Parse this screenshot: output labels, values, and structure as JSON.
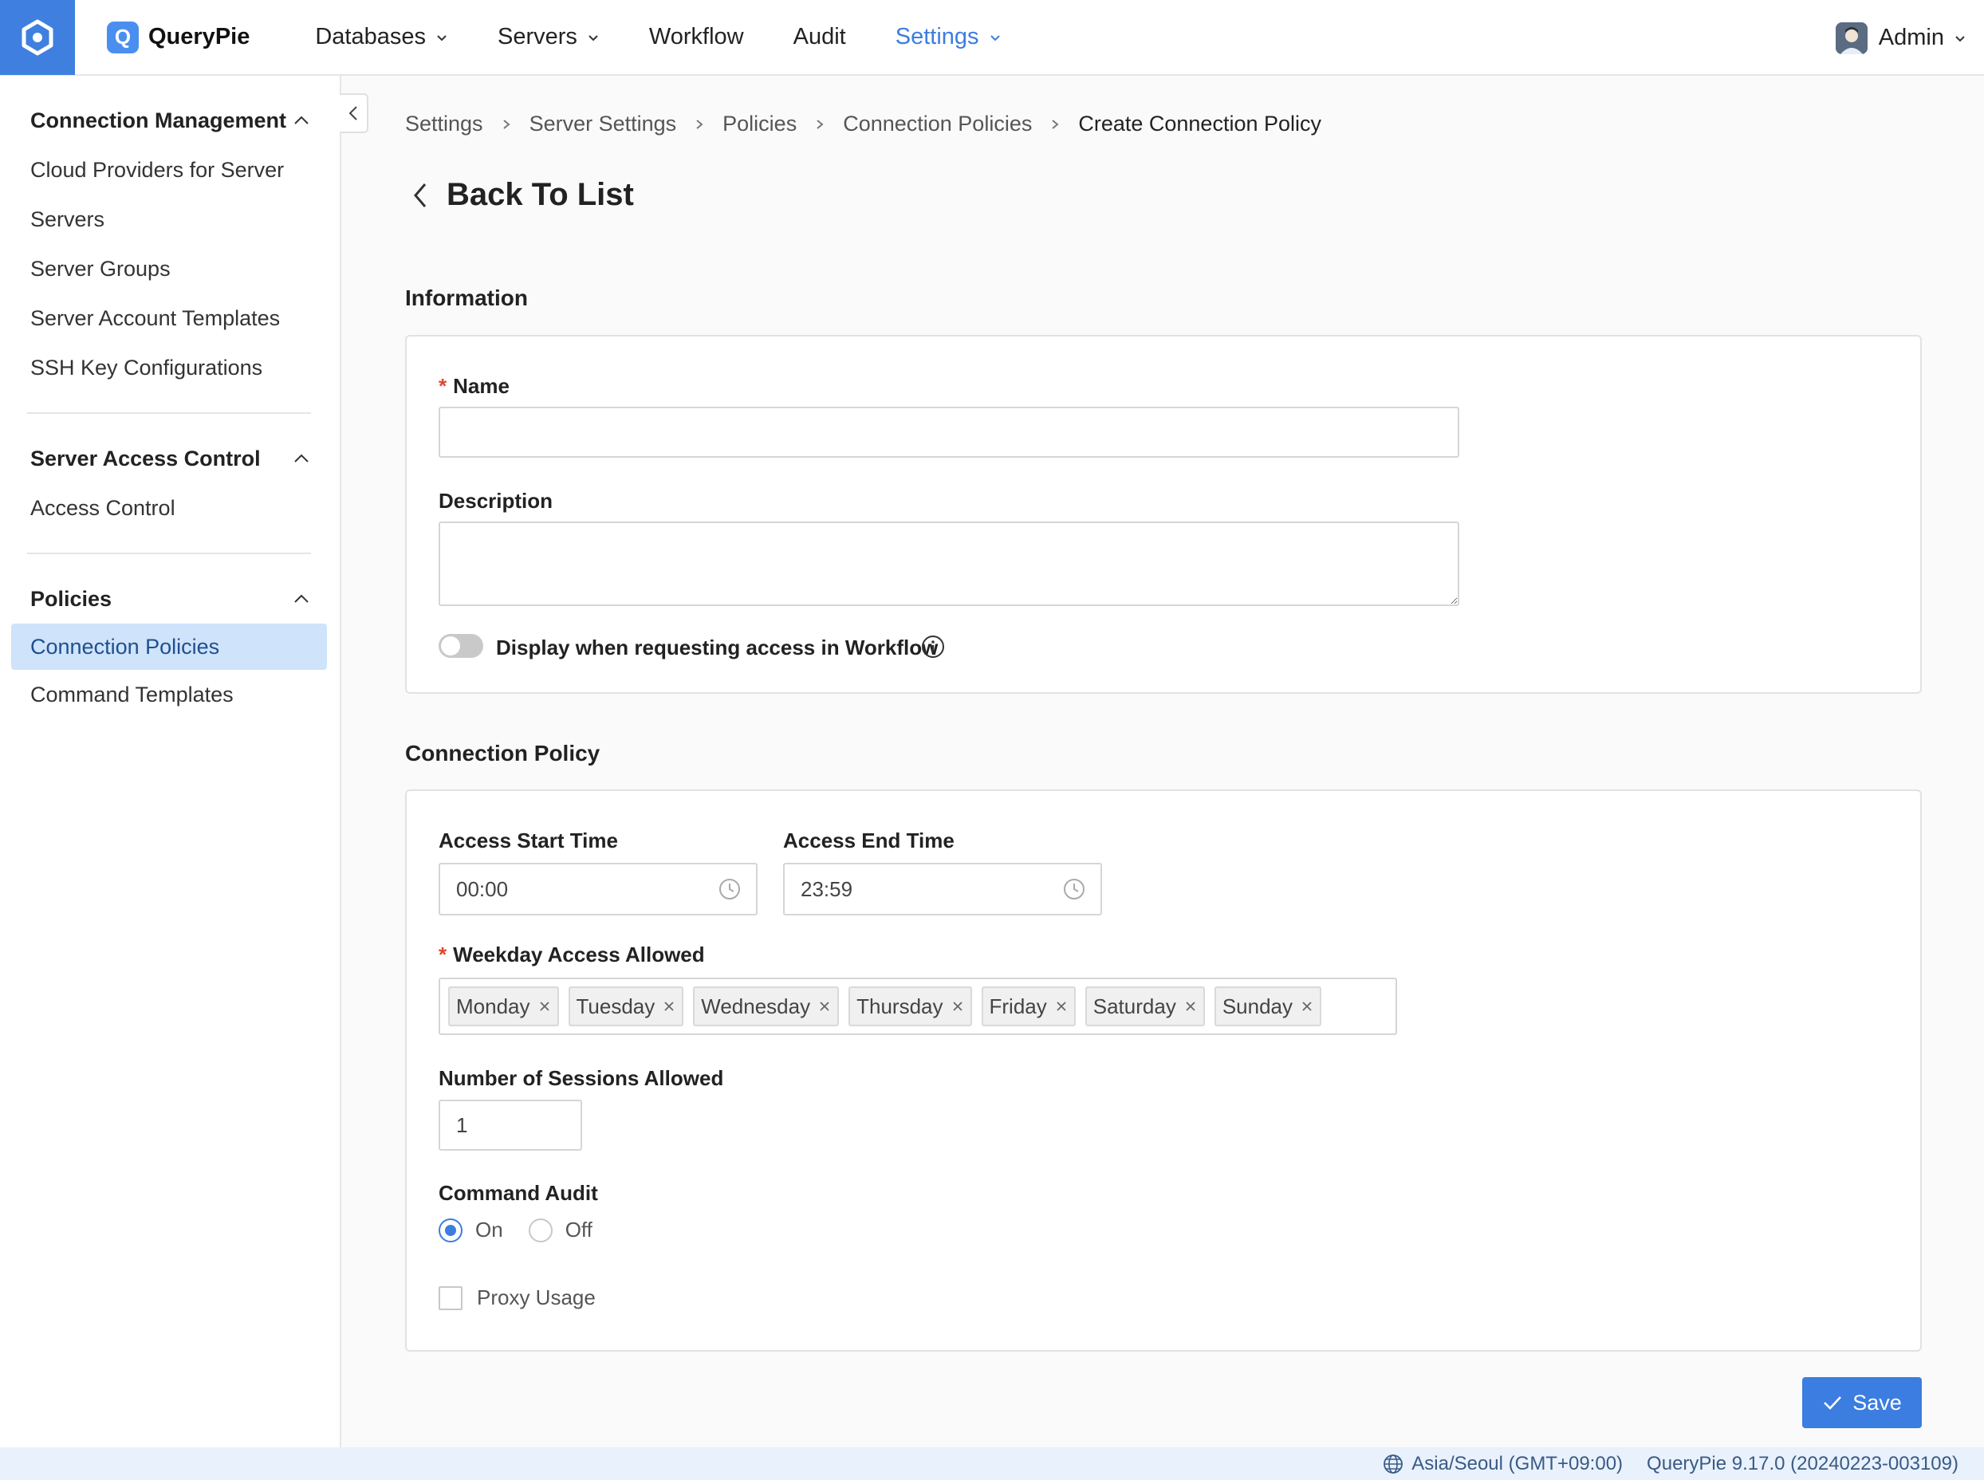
{
  "app": {
    "brand": "QueryPie",
    "brand_badge": "Q"
  },
  "nav": {
    "items": [
      {
        "label": "Databases",
        "dropdown": true
      },
      {
        "label": "Servers",
        "dropdown": true
      },
      {
        "label": "Workflow",
        "dropdown": false
      },
      {
        "label": "Audit",
        "dropdown": false
      },
      {
        "label": "Settings",
        "dropdown": true,
        "active": true
      }
    ],
    "user": "Admin"
  },
  "sidebar": {
    "groups": [
      {
        "title": "Connection Management",
        "items": [
          "Cloud Providers for Server",
          "Servers",
          "Server Groups",
          "Server Account Templates",
          "SSH Key Configurations"
        ]
      },
      {
        "title": "Server Access Control",
        "items": [
          "Access Control"
        ]
      },
      {
        "title": "Policies",
        "items": [
          "Connection Policies",
          "Command Templates"
        ],
        "active_item": "Connection Policies"
      }
    ]
  },
  "breadcrumb": [
    "Settings",
    "Server Settings",
    "Policies",
    "Connection Policies",
    "Create Connection Policy"
  ],
  "back_label": "Back To List",
  "information": {
    "title": "Information",
    "name_label": "Name",
    "name_value": "",
    "description_label": "Description",
    "description_value": "",
    "toggle_label": "Display when requesting access in Workflow",
    "toggle_on": false
  },
  "policy": {
    "title": "Connection Policy",
    "start_label": "Access Start Time",
    "start_value": "00:00",
    "end_label": "Access End Time",
    "end_value": "23:59",
    "weekday_label": "Weekday Access Allowed",
    "weekdays": [
      "Monday",
      "Tuesday",
      "Wednesday",
      "Thursday",
      "Friday",
      "Saturday",
      "Sunday"
    ],
    "sessions_label": "Number of Sessions Allowed",
    "sessions_value": "1",
    "audit_label": "Command Audit",
    "audit_on": "On",
    "audit_off": "Off",
    "audit_selected": "On",
    "proxy_label": "Proxy Usage",
    "proxy_checked": false
  },
  "save_label": "Save",
  "footer": {
    "timezone": "Asia/Seoul (GMT+09:00)",
    "version": "QueryPie 9.17.0 (20240223-003109)"
  },
  "colors": {
    "accent": "#3b7de0",
    "logo_bg": "#3f7fe0",
    "active_sidebar_bg": "#cfe3fb",
    "required": "#e0452f",
    "footer_bg": "#e8f1fc"
  }
}
